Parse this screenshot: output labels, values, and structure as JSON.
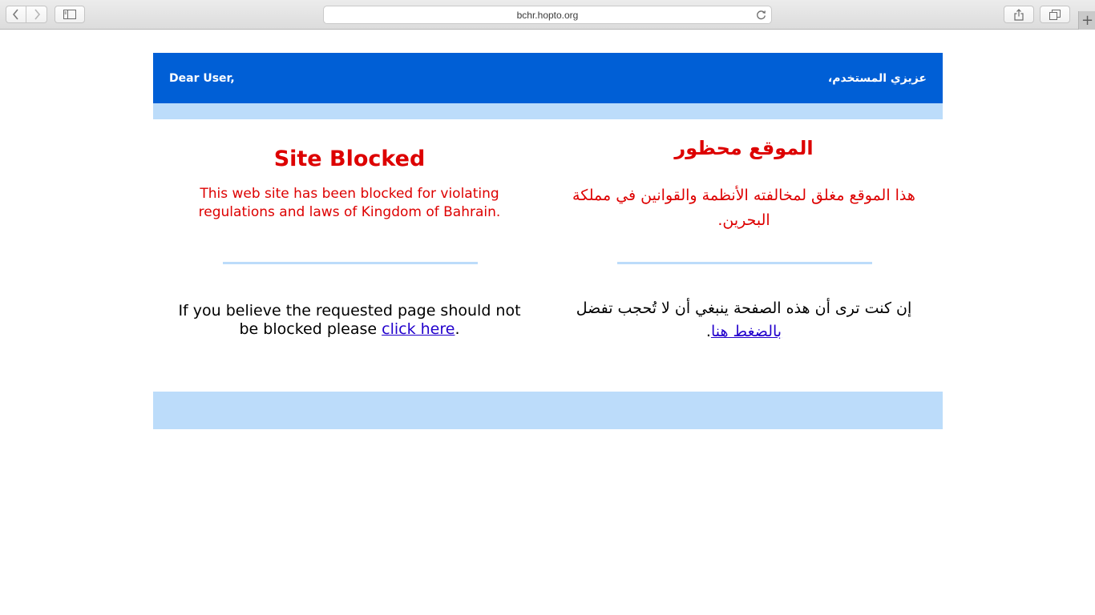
{
  "browser": {
    "url": "bchr.hopto.org",
    "new_tab_label": "+"
  },
  "header": {
    "greeting_en": "Dear User,",
    "greeting_ar": "عزيزي المستخدم،"
  },
  "english": {
    "title": "Site Blocked",
    "message": "This web site has been blocked for violating regulations and laws of Kingdom of Bahrain.",
    "note_prefix": "If you believe the requested page should not be blocked please ",
    "link_text": "click here",
    "note_suffix": "."
  },
  "arabic": {
    "title": "الموقع محظور",
    "message": "هذا الموقع مغلق لمخالفته الأنظمة والقوانين في مملكة البحرين.",
    "note_prefix": "إن كنت ترى أن هذه الصفحة ينبغي أن لا تُحجب تفضل ",
    "link_text": "بالضغط هنا",
    "note_suffix": "."
  },
  "colors": {
    "header_bg": "#005fd6",
    "strip_bg": "#bcdcfa",
    "title_red": "#dd0000",
    "link": "#2200cc"
  }
}
